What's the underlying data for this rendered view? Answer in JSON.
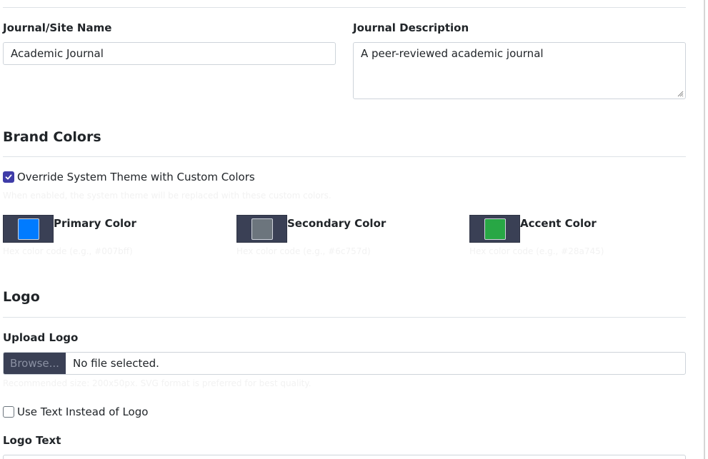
{
  "site": {
    "name_label": "Journal/Site Name",
    "name_value": "Academic Journal",
    "description_label": "Journal Description",
    "description_value": "A peer-reviewed academic journal"
  },
  "brand": {
    "heading": "Brand Colors",
    "override_label": "Override System Theme with Custom Colors",
    "override_checked": true,
    "override_help": "When enabled, the system theme will be replaced with these custom colors.",
    "colors": [
      {
        "label": "Primary Color",
        "value": "#007bff",
        "help": "Hex color code (e.g., #007bff)"
      },
      {
        "label": "Secondary Color",
        "value": "#6c757d",
        "help": "Hex color code (e.g., #6c757d)"
      },
      {
        "label": "Accent Color",
        "value": "#28a745",
        "help": "Hex color code (e.g., #28a745)"
      }
    ]
  },
  "logo": {
    "heading": "Logo",
    "upload_label": "Upload Logo",
    "browse_label": "Browse...",
    "file_status": "No file selected.",
    "upload_help": "Recommended size: 200x50px. SVG format is preferred for best quality.",
    "use_text_label": "Use Text Instead of Logo",
    "use_text_checked": false,
    "logo_text_label": "Logo Text"
  },
  "theme": {
    "checkbox_color": "#3f3ca8",
    "swatch_frame_color": "#3a4055"
  }
}
